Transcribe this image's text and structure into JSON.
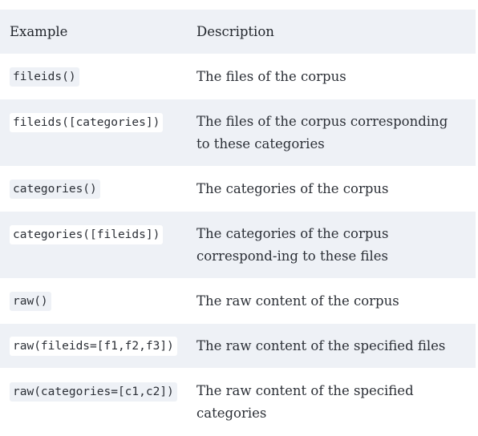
{
  "table": {
    "headers": {
      "example": "Example",
      "description": "Description"
    },
    "rows": [
      {
        "code": "fileids()",
        "description": "The files of the corpus"
      },
      {
        "code": "fileids([categories])",
        "description": "The files of the corpus corresponding to these categories"
      },
      {
        "code": "categories()",
        "description": "The categories of the corpus"
      },
      {
        "code": "categories([fileids])",
        "description": "The categories of the corpus correspond-ing to these files"
      },
      {
        "code": "raw()",
        "description": "The raw content of the corpus"
      },
      {
        "code": "raw(fileids=[f1,f2,f3])",
        "description": "The raw content of the specified files"
      },
      {
        "code": "raw(categories=[c1,c2])",
        "description": "The raw content of the specified categories"
      }
    ]
  }
}
